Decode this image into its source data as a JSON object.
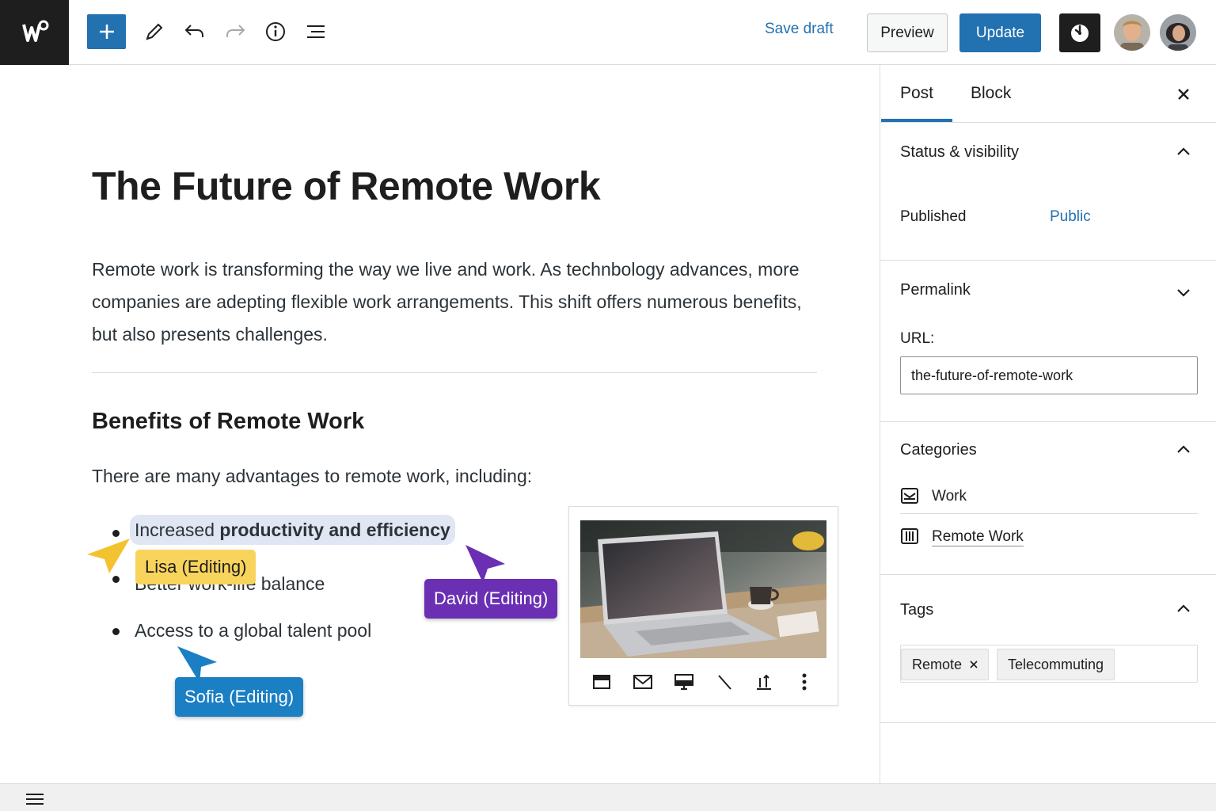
{
  "toolbar": {
    "add_block_icon": "plus-icon",
    "tools": [
      "pencil-icon",
      "undo-icon",
      "redo-icon",
      "info-icon",
      "list-view-icon"
    ],
    "save_draft": "Save draft",
    "preview": "Preview",
    "update": "Update",
    "plugin_icon": "performance-gauge-icon"
  },
  "editor": {
    "title": "The Future of Remote Work",
    "intro": "Remote work is transforming the way we live and work. As technbology advances, more companies are adepting flexible work arrangements. This shift offers numerous benefits, but also presents challenges.",
    "heading": "Benefits of Remote Work",
    "lead": "There are many advantages to remote work, including:",
    "list": {
      "item1_plain": "Increased ",
      "item1_bold": "productivity and efficiency",
      "item2": "Better work-life balance",
      "item3": "Access to a global talent pool"
    },
    "collaborators": {
      "lisa": "Lisa (Editing)",
      "david": "David (Editing)",
      "sofia": "Sofia (Editing)"
    },
    "collaborator_colors": {
      "lisa": "#f9d45c",
      "david": "#6a2fb3",
      "sofia": "#1b7fc4"
    }
  },
  "sidebar": {
    "tabs": [
      "Post",
      "Block"
    ],
    "active_tab": "Post",
    "status": {
      "title": "Status & visibility",
      "label": "Published",
      "value": "Public"
    },
    "permalink": {
      "title": "Permalink",
      "url_label": "URL:",
      "url_value": "the-future-of-remote-work"
    },
    "categories": {
      "title": "Categories",
      "items": [
        "Work",
        "Remote Work"
      ]
    },
    "tags": {
      "title": "Tags",
      "items": [
        "Remote",
        "Telecommuting"
      ]
    }
  },
  "colors": {
    "accent": "#2271b1",
    "dark": "#1e1e1e"
  }
}
